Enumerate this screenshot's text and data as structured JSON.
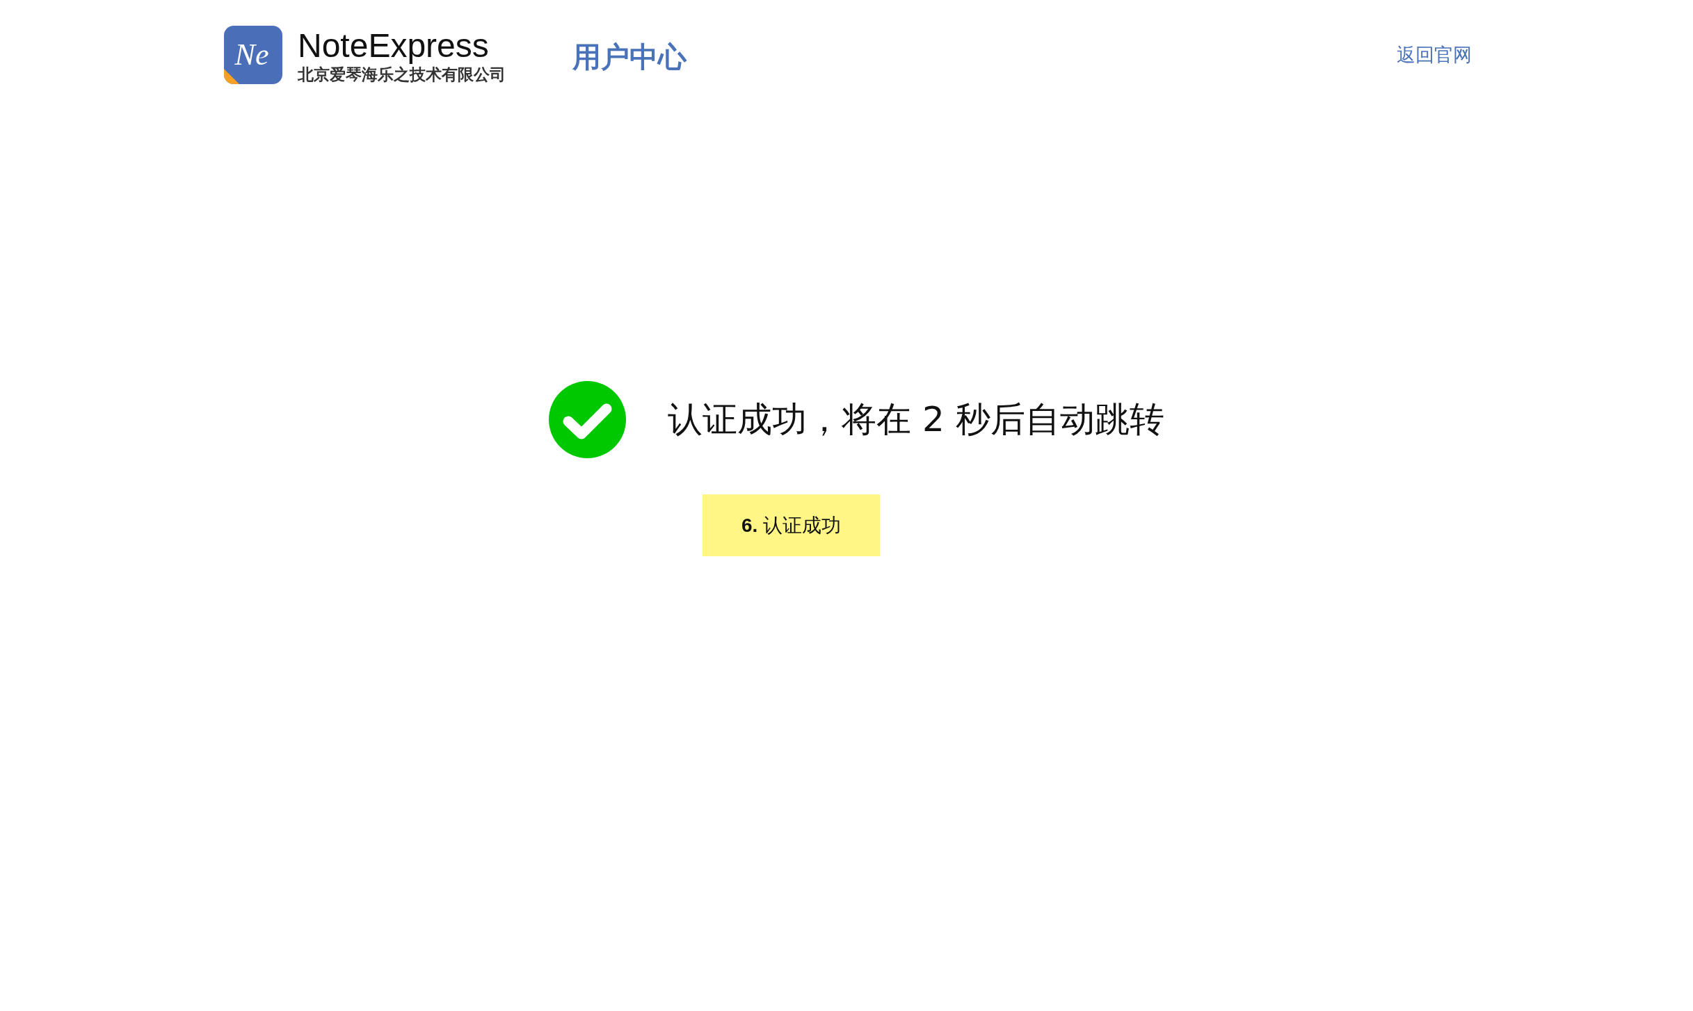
{
  "header": {
    "logo": {
      "mark": "Ne",
      "name": "NoteExpress",
      "company": "北京爱琴海乐之技术有限公司"
    },
    "title": "用户中心",
    "link": "返回官网"
  },
  "result": {
    "kind": "success",
    "message": "认证成功，将在 2 秒后自动跳转"
  },
  "note": {
    "text": "**6.** 认证成功"
  }
}
